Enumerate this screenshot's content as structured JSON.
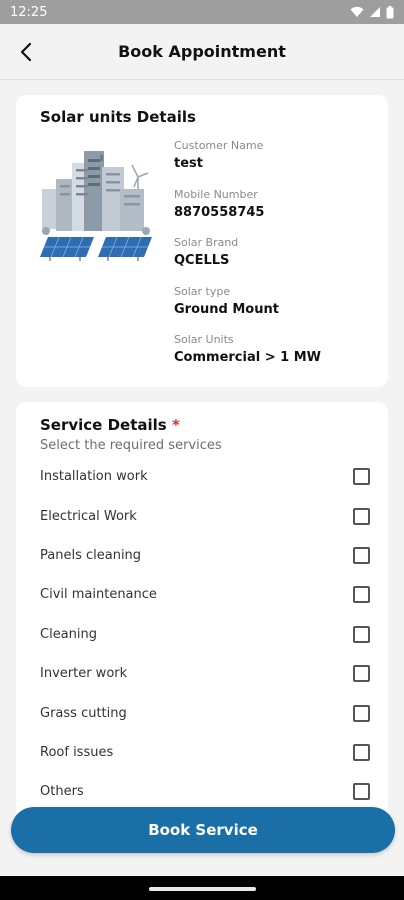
{
  "status_bar": {
    "time": "12:25",
    "icons": [
      "wifi-icon",
      "signal-icon",
      "battery-icon"
    ]
  },
  "header": {
    "title": "Book Appointment",
    "back_icon": "back-arrow-icon"
  },
  "solar_card": {
    "title": "Solar units Details",
    "illustration": "solar-buildings-illustration",
    "fields": [
      {
        "label": "Customer Name",
        "value": "test"
      },
      {
        "label": "Mobile Number",
        "value": "8870558745"
      },
      {
        "label": "Solar Brand",
        "value": "QCELLS"
      },
      {
        "label": "Solar type",
        "value": "Ground Mount"
      },
      {
        "label": "Solar Units",
        "value": "Commercial > 1 MW"
      }
    ]
  },
  "service_card": {
    "title": "Service Details",
    "required_marker": "*",
    "subtitle": "Select the required services",
    "services": [
      {
        "label": "Installation work",
        "checked": false
      },
      {
        "label": "Electrical Work",
        "checked": false
      },
      {
        "label": "Panels cleaning",
        "checked": false
      },
      {
        "label": "Civil maintenance",
        "checked": false
      },
      {
        "label": "Cleaning",
        "checked": false
      },
      {
        "label": "Inverter work",
        "checked": false
      },
      {
        "label": "Grass cutting",
        "checked": false
      },
      {
        "label": "Roof issues",
        "checked": false
      },
      {
        "label": "Others",
        "checked": false
      }
    ]
  },
  "book_button": {
    "label": "Book Service"
  },
  "colors": {
    "primary": "#1a6fa7",
    "background": "#f3f3f3",
    "card": "#ffffff",
    "required": "#e0302e",
    "status_bar": "#9e9e9e"
  }
}
